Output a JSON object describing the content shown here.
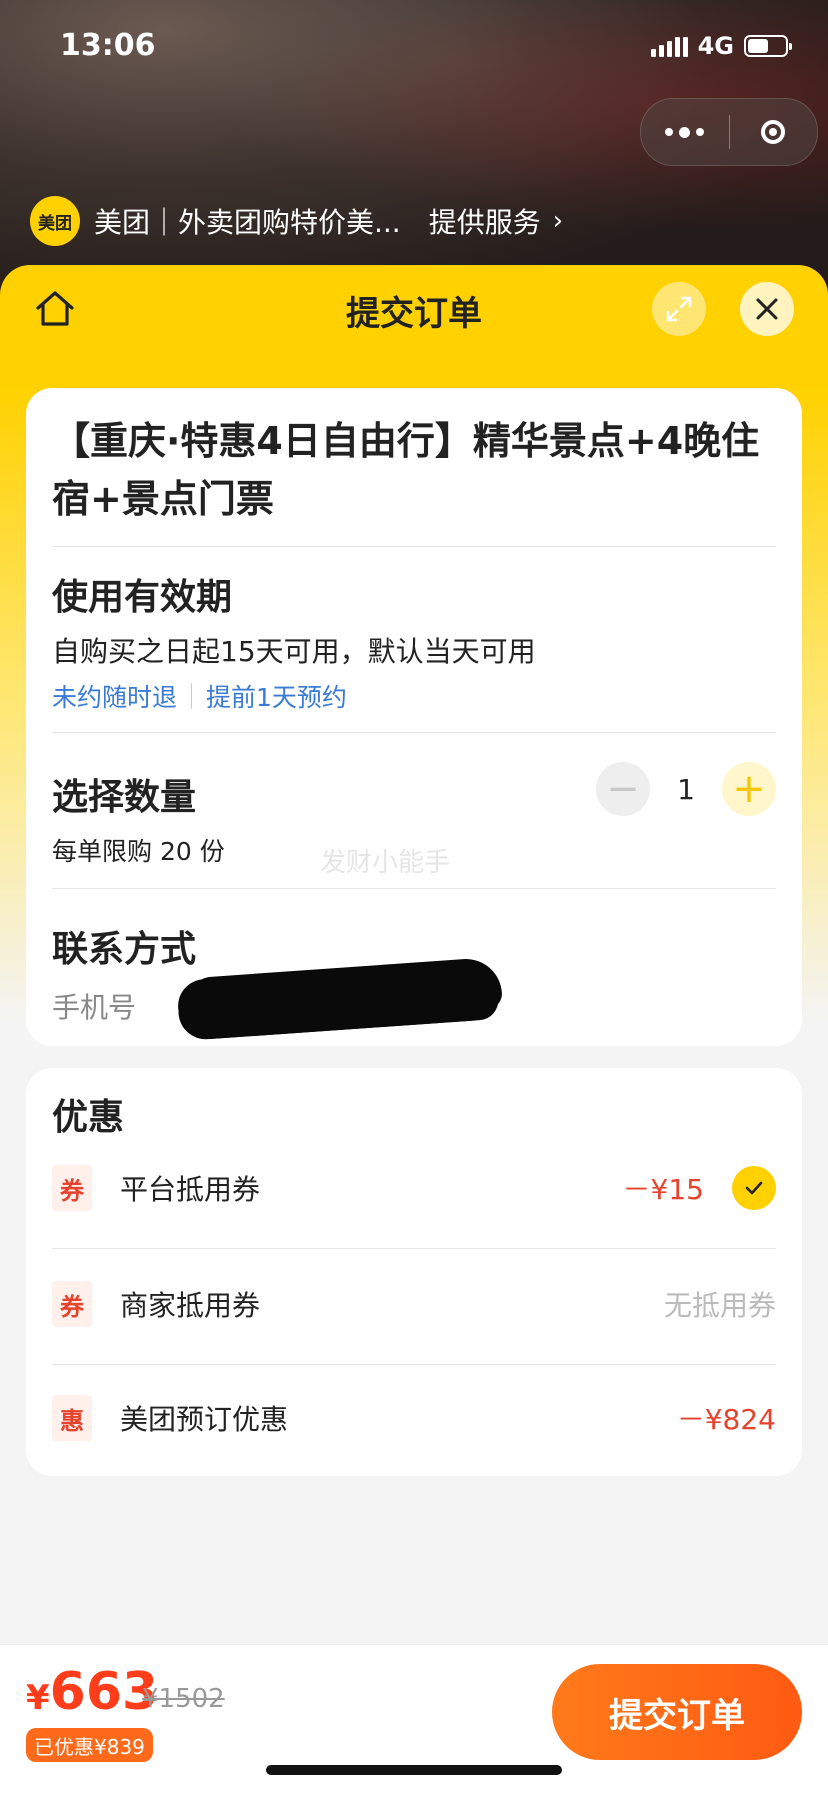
{
  "status": {
    "time": "13:06",
    "network": "4G"
  },
  "provider": {
    "logo_text": "美团",
    "name": "美团｜外卖团购特价美...",
    "service_link": "提供服务",
    "chevron": "›"
  },
  "header": {
    "title": "提交订单",
    "home_icon": "home-icon",
    "expand_icon": "expand-icon",
    "close_icon": "close-icon"
  },
  "product": {
    "title": "【重庆·特惠4日自由行】精华景点+4晚住宿+景点门票"
  },
  "validity": {
    "heading": "使用有效期",
    "desc": "自购买之日起15天可用，默认当天可用",
    "tag1": "未约随时退",
    "tag2": "提前1天预约"
  },
  "quantity": {
    "heading": "选择数量",
    "value": "1",
    "minus": "−",
    "plus": "+",
    "limit": "每单限购 20 份"
  },
  "contact": {
    "heading": "联系方式",
    "phone_label": "手机号"
  },
  "watermark": "发财小能手",
  "discounts": {
    "heading": "优惠",
    "items": [
      {
        "tag": "券",
        "label": "平台抵用券",
        "value": "－¥15"
      },
      {
        "tag": "券",
        "label": "商家抵用券",
        "value": "无抵用券"
      },
      {
        "tag": "惠",
        "label": "美团预订优惠",
        "value": "－¥824"
      }
    ]
  },
  "footer": {
    "currency": "¥",
    "price": "663",
    "original": "¥1502",
    "saved": "已优惠¥839",
    "submit": "提交订单"
  },
  "colors": {
    "brand_yellow": "#ffd100",
    "accent_orange": "#ff5a12",
    "discount_red": "#e5432d",
    "link_blue": "#3a7bd5"
  }
}
